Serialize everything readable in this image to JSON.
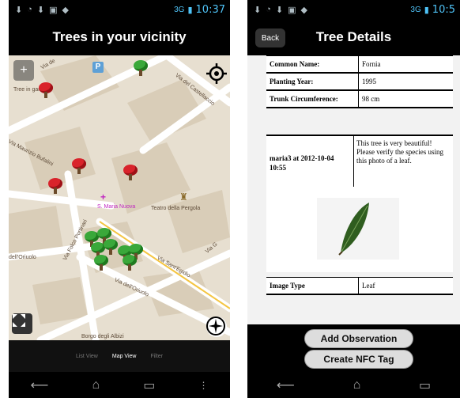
{
  "left": {
    "status": {
      "time": "10:37",
      "signal": "3G"
    },
    "title": "Trees in your vicinity",
    "map": {
      "labels": {
        "tree_in_garden": "Tree in garden",
        "via_del_castellaccio": "Via del Castellaccio",
        "via_maurizio_bufalini": "Via Maurizio Bufalini",
        "via_folco_portinari": "Via Folco Portinari",
        "dell_oriuolo": "dell'Oriuolo",
        "via_dell_oriuolo": "Via dell'Oriuolo",
        "via_sant_egidio": "Via Sant'Egidio",
        "teatro_della_pergola": "Teatro della Pergola",
        "s_maria_nuova": "S. Maria Nuova",
        "borgo_degli_albizi": "Borgo degli Albizi",
        "via_de": "Via de",
        "via_g": "Via G"
      }
    },
    "tabs": [
      {
        "label": "List View"
      },
      {
        "label": "Map View"
      },
      {
        "label": "Filter"
      }
    ]
  },
  "right": {
    "status": {
      "time": "10:5",
      "signal": "3G"
    },
    "back_label": "Back",
    "title": "Tree Details",
    "rows": [
      {
        "key": "Common Name:",
        "value": "Fornia"
      },
      {
        "key": "Planting Year:",
        "value": "1995"
      },
      {
        "key": "Trunk Circumference:",
        "value": "98 cm"
      }
    ],
    "observation": {
      "who": "maria3 at 2012-10-04 10:55",
      "text": "This tree is very beautiful! Please verify the species using this photo of a leaf."
    },
    "image_type": {
      "key": "Image Type",
      "value": "Leaf"
    },
    "buttons": {
      "add_observation": "Add Observation",
      "create_nfc": "Create NFC Tag"
    }
  },
  "colors": {
    "accent": "#4fc3f7",
    "tree_green": "#3aa83a",
    "tree_red": "#d9232b"
  }
}
